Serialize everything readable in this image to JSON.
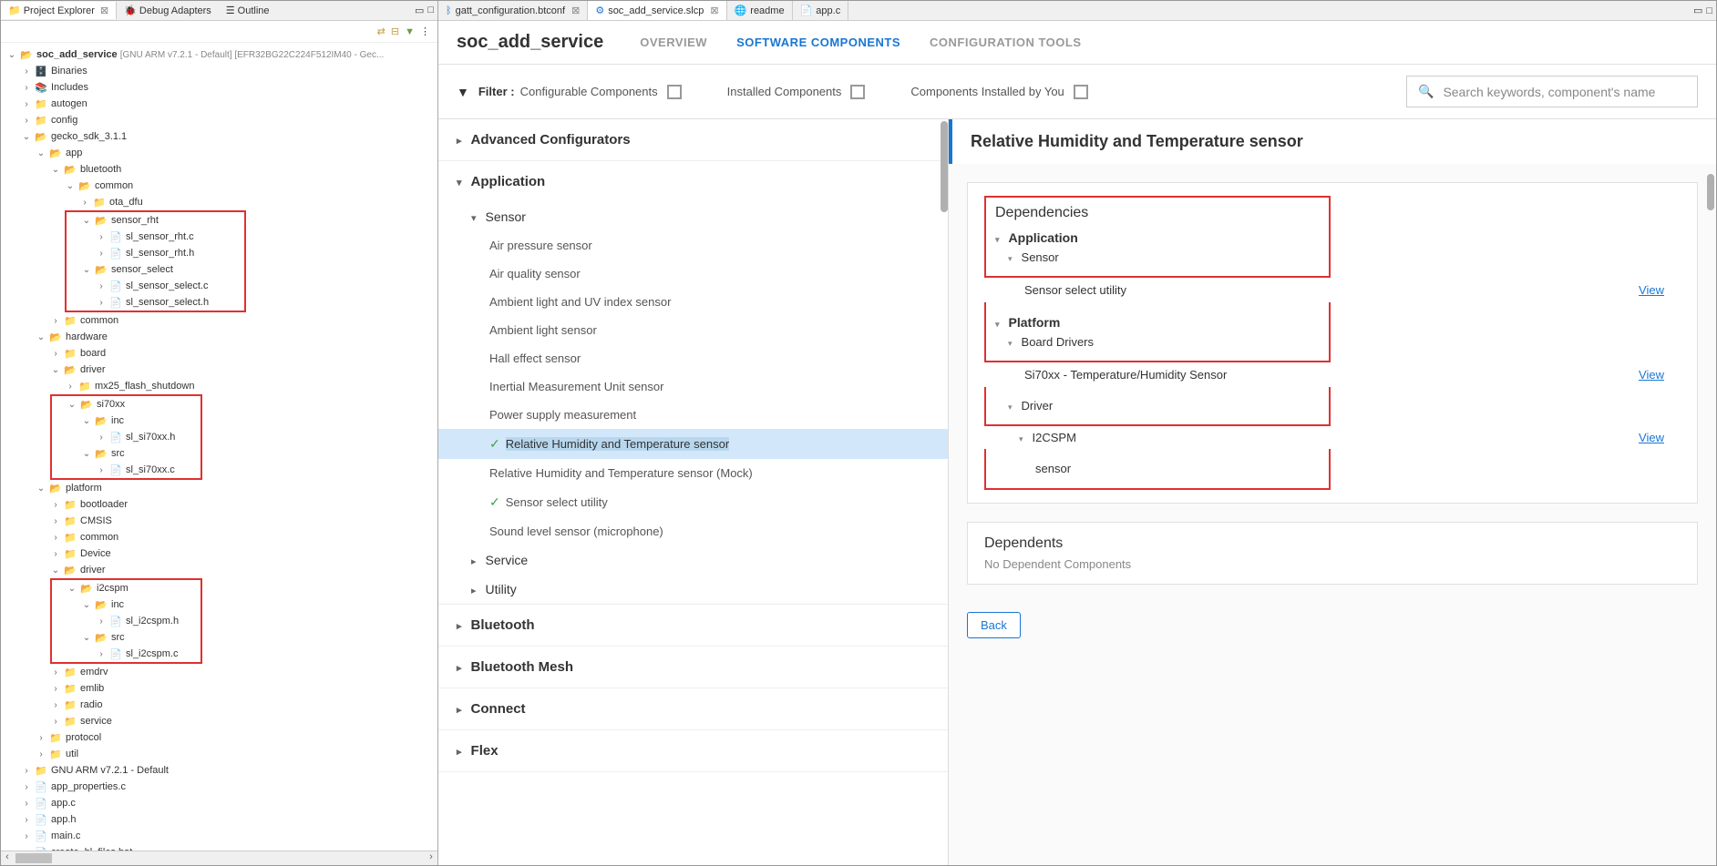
{
  "left_tabs": {
    "project_explorer": "Project Explorer",
    "debug_adapters": "Debug Adapters",
    "outline": "Outline"
  },
  "tree": {
    "project": "soc_add_service",
    "project_info": "[GNU ARM v7.2.1 - Default] [EFR32BG22C224F512IM40 - Gec...",
    "binaries": "Binaries",
    "includes": "Includes",
    "autogen": "autogen",
    "config": "config",
    "gecko_sdk": "gecko_sdk_3.1.1",
    "app": "app",
    "bluetooth": "bluetooth",
    "common": "common",
    "ota_dfu": "ota_dfu",
    "sensor_rht": "sensor_rht",
    "sl_sensor_rht_c": "sl_sensor_rht.c",
    "sl_sensor_rht_h": "sl_sensor_rht.h",
    "sensor_select": "sensor_select",
    "sl_sensor_select_c": "sl_sensor_select.c",
    "sl_sensor_select_h": "sl_sensor_select.h",
    "common2": "common",
    "hardware": "hardware",
    "board": "board",
    "driver": "driver",
    "mx25": "mx25_flash_shutdown",
    "si70xx": "si70xx",
    "inc": "inc",
    "sl_si70xx_h": "sl_si70xx.h",
    "src": "src",
    "sl_si70xx_c": "sl_si70xx.c",
    "platform": "platform",
    "bootloader": "bootloader",
    "cmsis": "CMSIS",
    "common3": "common",
    "device": "Device",
    "driver2": "driver",
    "i2cspm": "i2cspm",
    "inc2": "inc",
    "sl_i2cspm_h": "sl_i2cspm.h",
    "src2": "src",
    "sl_i2cspm_c": "sl_i2cspm.c",
    "emdrv": "emdrv",
    "emlib": "emlib",
    "radio": "radio",
    "service": "service",
    "protocol": "protocol",
    "util": "util",
    "gnu_arm": "GNU ARM v7.2.1 - Default",
    "app_properties_c": "app_properties.c",
    "app_c": "app.c",
    "app_h": "app.h",
    "main_c": "main.c",
    "create_bl": "create_bl_files.bat"
  },
  "editor_tabs": {
    "gatt": "gatt_configuration.btconf",
    "slcp": "soc_add_service.slcp",
    "readme": "readme",
    "appc": "app.c"
  },
  "header": {
    "title": "soc_add_service",
    "overview": "OVERVIEW",
    "software": "SOFTWARE COMPONENTS",
    "config": "CONFIGURATION TOOLS"
  },
  "filter": {
    "label": "Filter :",
    "configurable": "Configurable Components",
    "installed": "Installed Components",
    "by_you": "Components Installed by You",
    "search_placeholder": "Search keywords, component's name"
  },
  "components": {
    "advanced": "Advanced Configurators",
    "application": "Application",
    "sensor": "Sensor",
    "air_pressure": "Air pressure sensor",
    "air_quality": "Air quality sensor",
    "ambient_uv": "Ambient light and UV index sensor",
    "ambient": "Ambient light sensor",
    "hall": "Hall effect sensor",
    "imu": "Inertial Measurement Unit sensor",
    "power": "Power supply measurement",
    "rht": "Relative Humidity and Temperature sensor",
    "rht_mock": "Relative Humidity and Temperature sensor (Mock)",
    "sensor_select": "Sensor select utility",
    "sound": "Sound level sensor (microphone)",
    "service": "Service",
    "utility": "Utility",
    "bluetooth": "Bluetooth",
    "bt_mesh": "Bluetooth Mesh",
    "connect": "Connect",
    "flex": "Flex"
  },
  "detail": {
    "title": "Relative Humidity and Temperature sensor",
    "dependencies": "Dependencies",
    "application": "Application",
    "sensor": "Sensor",
    "sensor_select": "Sensor select utility",
    "platform": "Platform",
    "board_drivers": "Board Drivers",
    "si70xx": "Si70xx - Temperature/Humidity Sensor",
    "driver": "Driver",
    "i2cspm": "I2CSPM",
    "sensor_item": "sensor",
    "view": "View",
    "dependents": "Dependents",
    "no_dependents": "No Dependent Components",
    "back": "Back"
  }
}
